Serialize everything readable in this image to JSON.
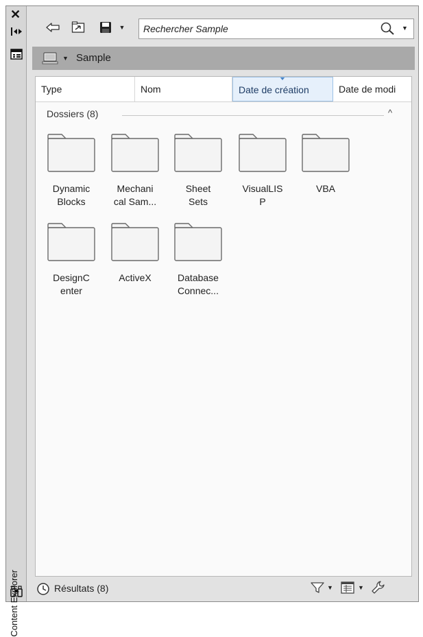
{
  "side_panel": {
    "title": "Content Explorer",
    "icons": [
      "close-icon",
      "pin-icon",
      "panel-menu-icon",
      "binoculars-icon"
    ]
  },
  "toolbar": {
    "icons": [
      "back-arrow-icon",
      "folder-up-icon",
      "save-icon",
      "chevron-down-icon"
    ]
  },
  "search": {
    "placeholder": "Rechercher Sample",
    "icon": "search-icon"
  },
  "path": {
    "label": "Sample",
    "icon": "computer-icon"
  },
  "columns": [
    "Type",
    "Nom",
    "Date de création",
    "Date de modi"
  ],
  "active_column": "Date de création",
  "group": {
    "label": "Dossiers (8)"
  },
  "folders": [
    {
      "line1": "Dynamic",
      "line2": "Blocks"
    },
    {
      "line1": "Mechani",
      "line2": "cal Sam..."
    },
    {
      "line1": "Sheet",
      "line2": "Sets"
    },
    {
      "line1": "VisualLIS",
      "line2": "P"
    },
    {
      "line1": "VBA",
      "line2": ""
    },
    {
      "line1": "DesignC",
      "line2": "enter"
    },
    {
      "line1": "ActiveX",
      "line2": ""
    },
    {
      "line1": "Database",
      "line2": "Connec..."
    }
  ],
  "status": {
    "results": "Résultats (8)",
    "icons": [
      "clock-icon",
      "filter-icon",
      "view-icon",
      "settings-wrench-icon"
    ]
  }
}
